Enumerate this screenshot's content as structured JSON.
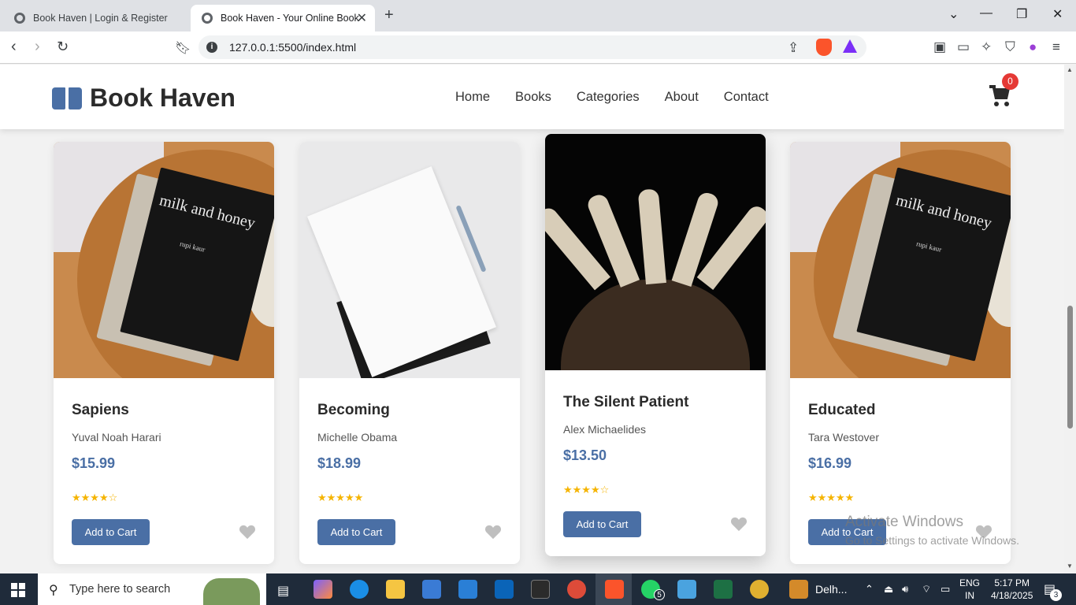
{
  "browser": {
    "tabs": [
      {
        "title": "Book Haven | Login & Register",
        "active": false
      },
      {
        "title": "Book Haven - Your Online Book",
        "active": true
      }
    ],
    "url": "127.0.0.1:5500/index.html"
  },
  "site": {
    "logo_text": "Book Haven",
    "nav": [
      "Home",
      "Books",
      "Categories",
      "About",
      "Contact"
    ],
    "cart_count": "0",
    "accent_color": "#4a6fa5"
  },
  "books": [
    {
      "title": "Sapiens",
      "author": "Yuval Noah Harari",
      "price": "$15.99",
      "rating": 4,
      "stars": "★★★★☆",
      "button": "Add to Cart",
      "image": "milk-and-honey-book-photo"
    },
    {
      "title": "Becoming",
      "author": "Michelle Obama",
      "price": "$18.99",
      "rating": 5,
      "stars": "★★★★★",
      "button": "Add to Cart",
      "image": "notebook-photo"
    },
    {
      "title": "The Silent Patient",
      "author": "Alex Michaelides",
      "price": "$13.50",
      "rating": 4,
      "stars": "★★★★☆",
      "button": "Add to Cart",
      "image": "open-book-photo"
    },
    {
      "title": "Educated",
      "author": "Tara Westover",
      "price": "$16.99",
      "rating": 5,
      "stars": "★★★★★",
      "button": "Add to Cart",
      "image": "milk-and-honey-book-photo"
    }
  ],
  "image_text": {
    "book_title": "milk and honey",
    "book_author": "rupi kaur"
  },
  "watermark": {
    "line1": "Activate Windows",
    "line2": "Go to Settings to activate Windows."
  },
  "taskbar": {
    "search_placeholder": "Type here to search",
    "pinned_label": "Delh...",
    "language": "ENG",
    "region": "IN",
    "time": "5:17 PM",
    "date": "4/18/2025",
    "notifications": "3",
    "whatsapp_badge": "5"
  }
}
